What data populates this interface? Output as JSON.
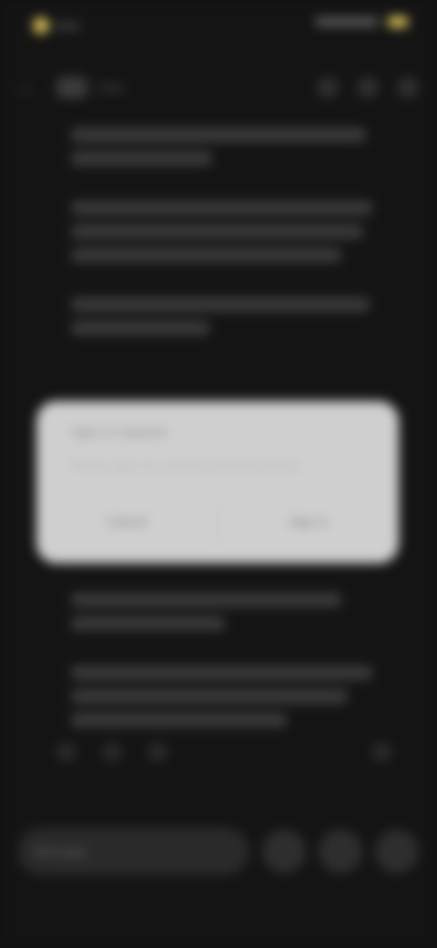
{
  "status_bar": {
    "time": "9:41",
    "accent_color": "#d9c25a"
  },
  "top_bar": {
    "title": "Chat",
    "icons": [
      "back-arrow-icon",
      "logo-icon",
      "more-icon-1",
      "more-icon-2",
      "more-icon-3"
    ]
  },
  "content": {
    "paragraph_count": 3
  },
  "dialog": {
    "title": "Sign in required",
    "message": "Please sign in to continue using this feature.",
    "buttons": [
      {
        "label": "Cancel"
      },
      {
        "label": "Sign in"
      }
    ]
  },
  "bottom_text": {
    "lines": 2
  },
  "composer": {
    "placeholder": "Message"
  }
}
